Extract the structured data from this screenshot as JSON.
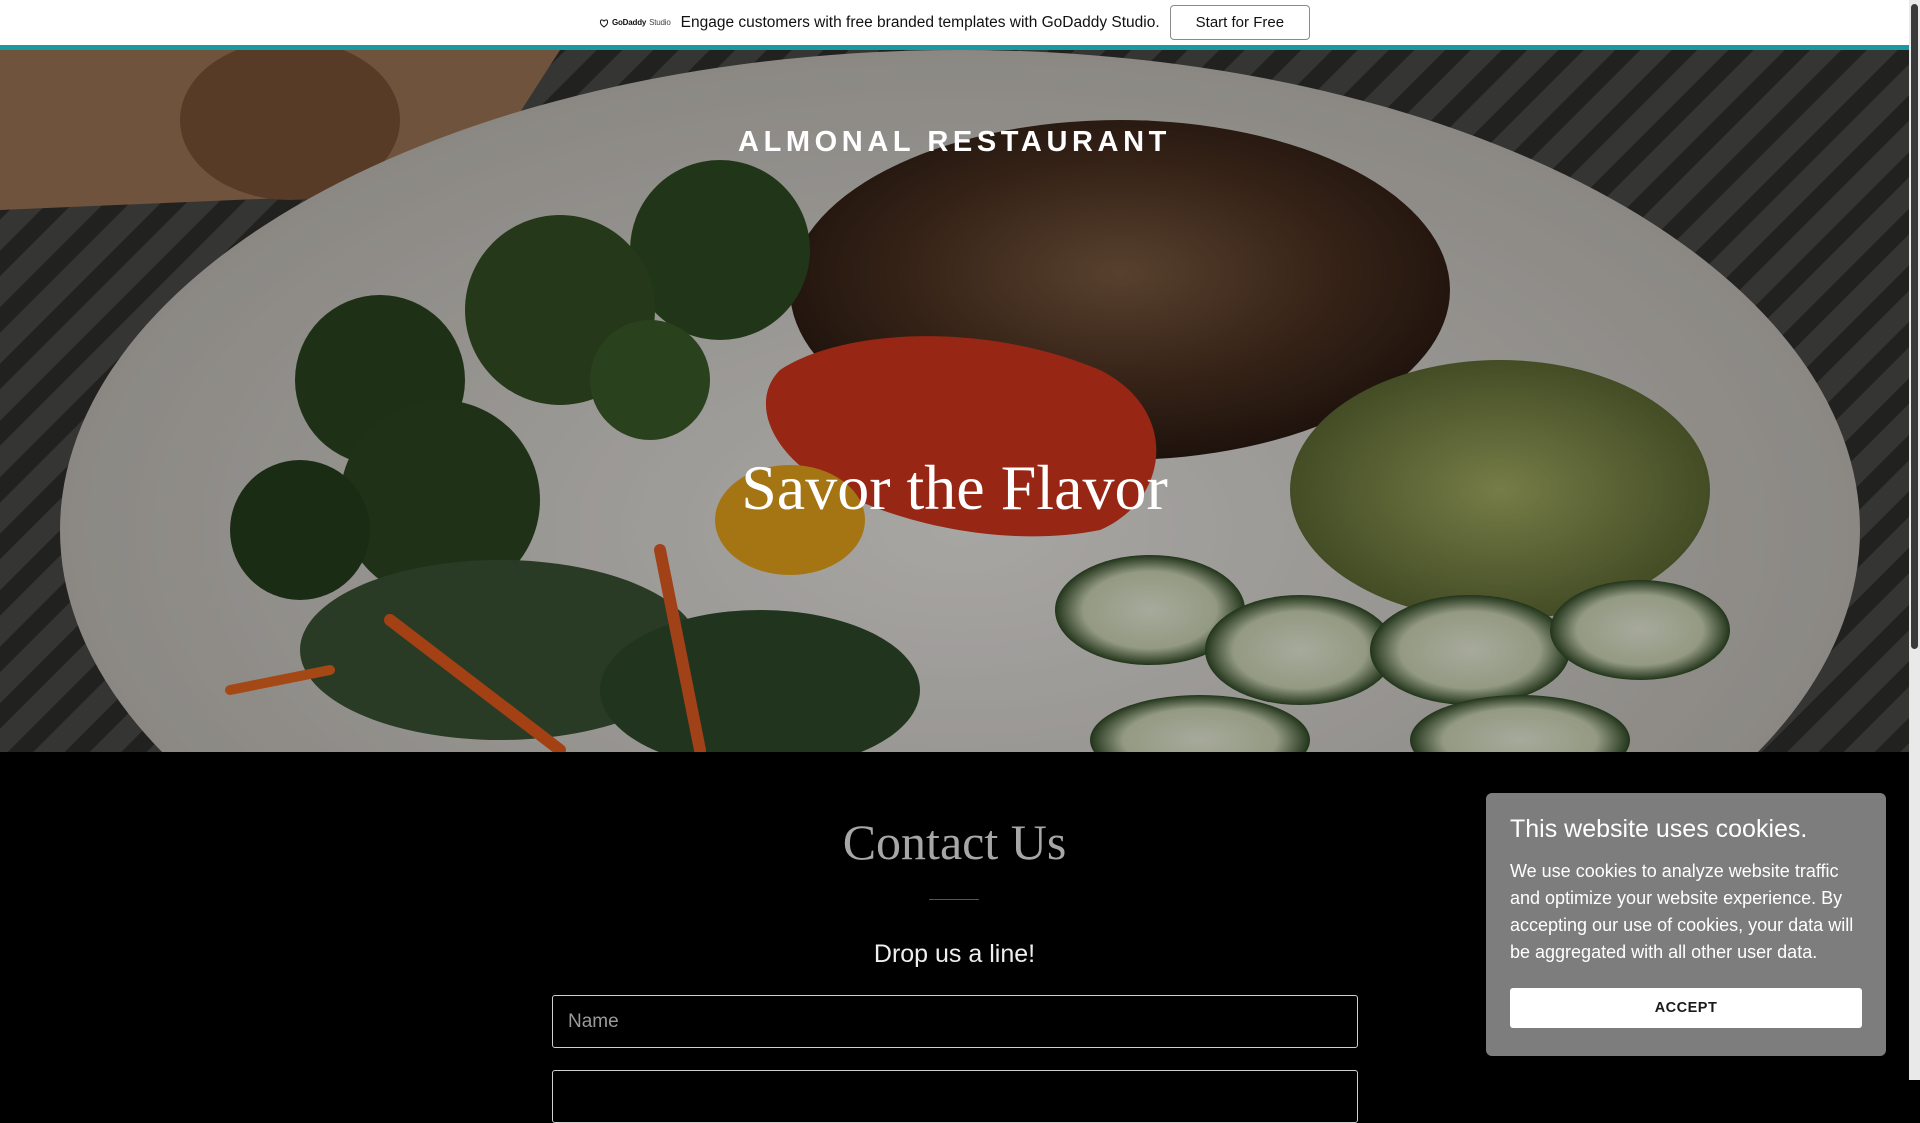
{
  "promo_bar": {
    "logo_brand": "GoDaddy",
    "logo_product": "Studio",
    "message": "Engage customers with free branded templates with GoDaddy Studio.",
    "cta_label": "Start for Free"
  },
  "hero": {
    "brand_name": "ALMONAL RESTAURANT",
    "tagline": "Savor the Flavor"
  },
  "contact": {
    "title": "Contact Us",
    "subtitle": "Drop us a line!",
    "name_placeholder": "Name",
    "email_placeholder": ""
  },
  "cookie_banner": {
    "title": "This website uses cookies.",
    "body": "We use cookies to analyze website traffic and optimize your website experience. By accepting our use of cookies, your data will be aggregated with all other user data.",
    "accept_label": "ACCEPT"
  },
  "colors": {
    "accent_teal": "#1a9aa0",
    "cookie_bg": "#7d7d7d",
    "page_bg": "#000000"
  }
}
